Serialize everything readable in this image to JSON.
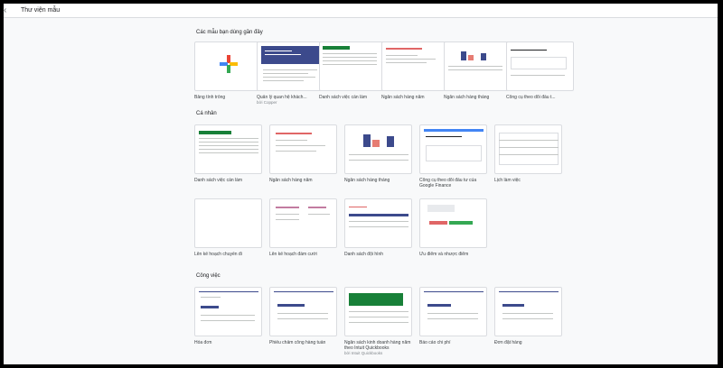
{
  "app": {
    "title": "Thư viện mẫu"
  },
  "sections": {
    "recent": {
      "title": "Các mẫu bạn dùng gần đây",
      "items": [
        {
          "label": "Bảng tính trống"
        },
        {
          "label": "Quản lý quan hệ khách...",
          "sublabel": "bởi Copper"
        },
        {
          "label": "Danh sách việc cần làm"
        },
        {
          "label": "Ngân sách hàng năm"
        },
        {
          "label": "Ngân sách hàng tháng"
        },
        {
          "label": "Công cụ theo dõi đầu t..."
        }
      ]
    },
    "personal": {
      "title": "Cá nhân",
      "items": [
        {
          "label": "Danh sách việc cần làm"
        },
        {
          "label": "Ngân sách hàng năm"
        },
        {
          "label": "Ngân sách hàng tháng"
        },
        {
          "label": "Công cụ theo dõi đầu tư của Google Finance"
        },
        {
          "label": "Lịch làm việc"
        },
        {
          "label": "Lên kế hoạch chuyến đi"
        },
        {
          "label": "Lên kế hoạch đám cưới"
        },
        {
          "label": "Danh sách đội hình"
        },
        {
          "label": "Ưu điểm và nhược điểm"
        }
      ]
    },
    "work": {
      "title": "Công việc",
      "items": [
        {
          "label": "Hóa đơn"
        },
        {
          "label": "Phiếu chấm công hàng tuần"
        },
        {
          "label": "Ngân sách kinh doanh hàng năm theo Intuit Quickbooks",
          "sublabel": "bởi Intuit Quickbooks"
        },
        {
          "label": "Báo cáo chi phí"
        },
        {
          "label": "Đơn đặt hàng"
        }
      ]
    }
  },
  "colors": {
    "google_blue": "#4285f4",
    "google_red": "#ea4335",
    "google_yellow": "#fbbc04",
    "google_green": "#34a853",
    "sheets_green": "#188038",
    "navy": "#3c4a8c"
  }
}
